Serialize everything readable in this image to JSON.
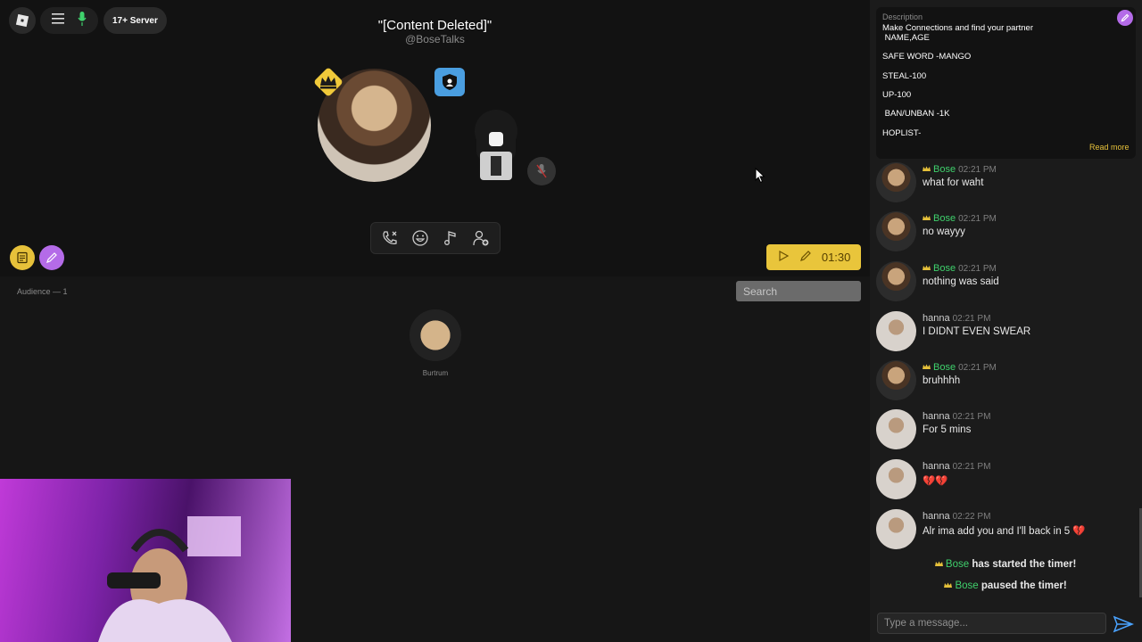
{
  "topbar": {
    "server_badge": "17+ Server"
  },
  "room": {
    "title": "\"[Content Deleted]\"",
    "handle": "@BoseTalks"
  },
  "timer": {
    "value": "01:30"
  },
  "audience": {
    "label": "Audience — 1",
    "members": [
      {
        "name": "Burtrum"
      }
    ]
  },
  "search": {
    "placeholder": "Search"
  },
  "description": {
    "label": "Description",
    "text": "Make Connections and find your partner\n NAME,AGE\n\nSAFE WORD -MANGO\n\nSTEAL-100\n\nUP-100\n\n BAN/UNBAN -1K\n\nHOPLIST-",
    "read_more": "Read more"
  },
  "messages": [
    {
      "name": "Bose",
      "time": "02:21 PM",
      "text": "what for waht",
      "host": true
    },
    {
      "name": "Bose",
      "time": "02:21 PM",
      "text": "no wayyy",
      "host": true
    },
    {
      "name": "Bose",
      "time": "02:21 PM",
      "text": "nothing was said",
      "host": true
    },
    {
      "name": "hanna",
      "time": "02:21 PM",
      "text": "I DIDNT EVEN SWEAR",
      "host": false
    },
    {
      "name": "Bose",
      "time": "02:21 PM",
      "text": "bruhhhh",
      "host": true
    },
    {
      "name": "hanna",
      "time": "02:21 PM",
      "text": "For 5 mins",
      "host": false
    },
    {
      "name": "hanna",
      "time": "02:21 PM",
      "text": "💔💔",
      "host": false
    },
    {
      "name": "hanna",
      "time": "02:22 PM",
      "text": "Alr ima add you and I'll back in 5 💔",
      "host": false
    }
  ],
  "system_messages": [
    {
      "name": "Bose",
      "text": "has started the timer!"
    },
    {
      "name": "Bose",
      "text": "paused the timer!"
    }
  ],
  "composer": {
    "placeholder": "Type a message..."
  },
  "colors": {
    "accent_yellow": "#e9c53b",
    "accent_purple": "#b46be8",
    "host_green": "#3fd16c"
  }
}
